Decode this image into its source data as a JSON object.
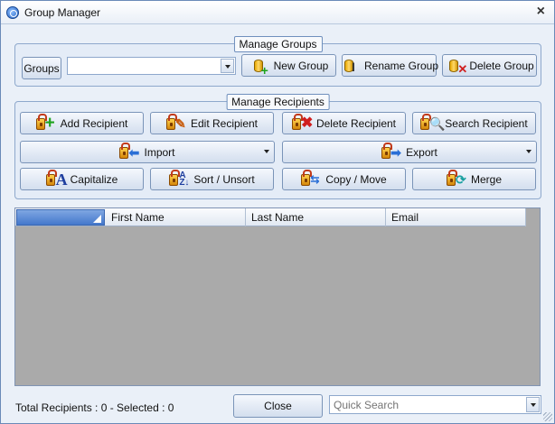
{
  "window": {
    "title": "Group Manager",
    "close_glyph": "×",
    "app_icon": "app-icon",
    "close_icon": "close-icon"
  },
  "manage_groups": {
    "title": "Manage Groups",
    "groups_label": "Groups",
    "groups_value": "",
    "new_group": "New Group",
    "rename_group": "Rename Group",
    "delete_group": "Delete Group"
  },
  "manage_recipients": {
    "title": "Manage Recipients",
    "add": "Add Recipient",
    "edit": "Edit Recipient",
    "delete": "Delete Recipient",
    "search": "Search Recipient",
    "import": "Import",
    "export": "Export",
    "capitalize": "Capitalize",
    "sort": "Sort / Unsort",
    "copy_move": "Copy / Move",
    "merge": "Merge"
  },
  "grid": {
    "columns": [
      "First Name",
      "Last Name",
      "Email"
    ],
    "rows": []
  },
  "footer": {
    "total": "Total Recipients : 0 - Selected : 0",
    "close": "Close",
    "quick_search_placeholder": "Quick Search"
  },
  "colors": {
    "window_bg": "#eaf0f8",
    "accent": "#4478cc",
    "grid_bg": "#aaaaaa"
  }
}
